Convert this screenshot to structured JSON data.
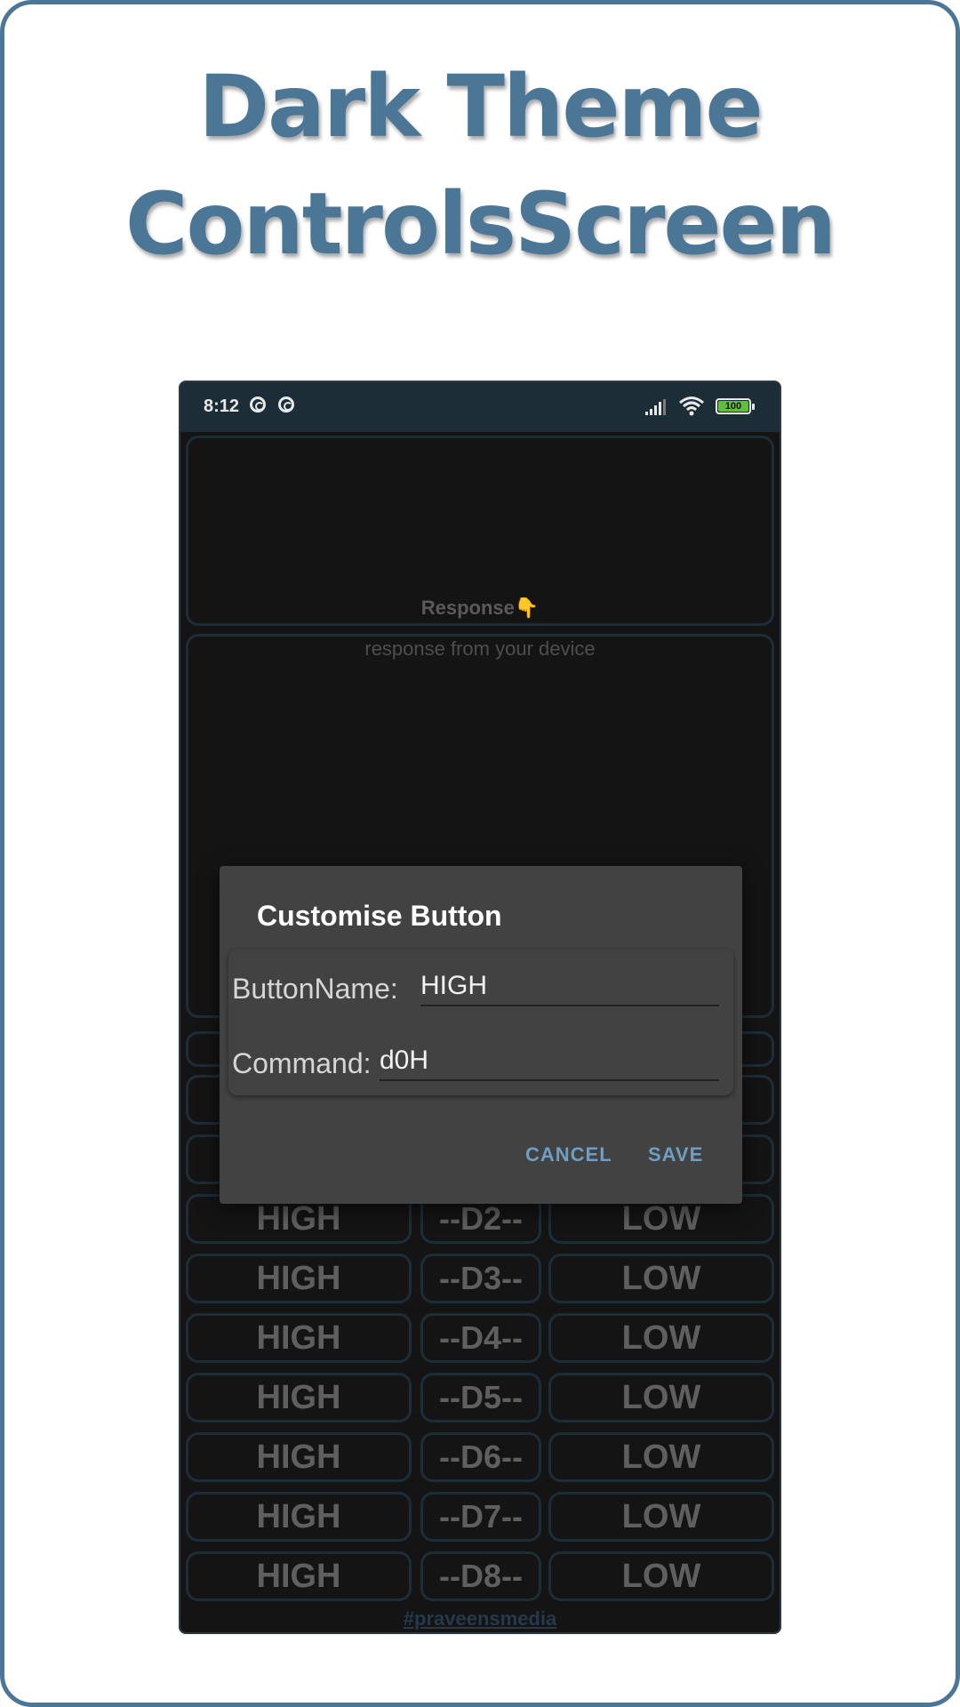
{
  "headline": {
    "line1": "Dark Theme",
    "line2": "ControlsScreen"
  },
  "status_bar": {
    "time": "8:12",
    "battery": "100"
  },
  "response": {
    "title": "Response👇",
    "hint": "response from your device"
  },
  "rows": [
    {
      "high": "HIGH",
      "pin": "--D2--",
      "low": "LOW"
    },
    {
      "high": "HIGH",
      "pin": "--D3--",
      "low": "LOW"
    },
    {
      "high": "HIGH",
      "pin": "--D4--",
      "low": "LOW"
    },
    {
      "high": "HIGH",
      "pin": "--D5--",
      "low": "LOW"
    },
    {
      "high": "HIGH",
      "pin": "--D6--",
      "low": "LOW"
    },
    {
      "high": "HIGH",
      "pin": "--D7--",
      "low": "LOW"
    },
    {
      "high": "HIGH",
      "pin": "--D8--",
      "low": "LOW"
    }
  ],
  "footer": "#praveensmedia",
  "dialog": {
    "title": "Customise Button",
    "name_label": "ButtonName:",
    "name_value": "HIGH",
    "command_label": "Command:",
    "command_value": "d0H",
    "cancel": "CANCEL",
    "save": "SAVE"
  },
  "colors": {
    "accent": "#4b7696",
    "dialog_button": "#6f9ec2",
    "status_bar": "#1d2d38",
    "battery": "#5fbf3a"
  },
  "icons": [
    "signal-icon",
    "wifi-icon",
    "battery-icon",
    "location-icon",
    "hotspot-icon"
  ]
}
